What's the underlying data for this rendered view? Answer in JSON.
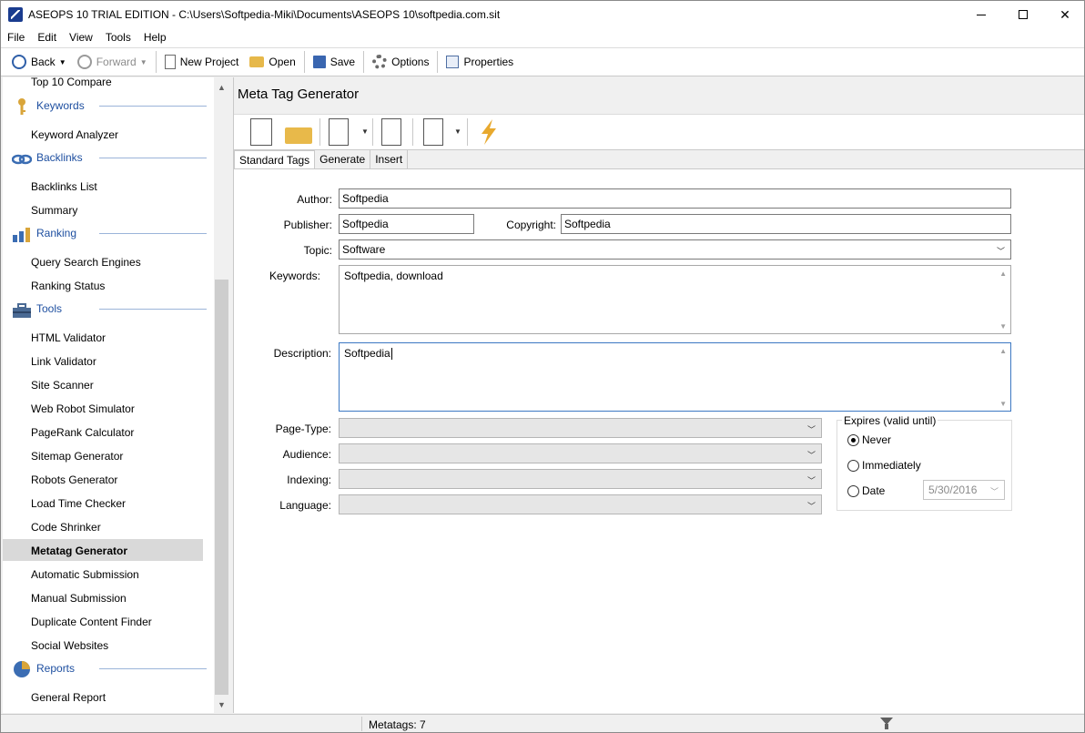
{
  "window": {
    "title": "ASEOPS 10 TRIAL EDITION - C:\\Users\\Softpedia-Miki\\Documents\\ASEOPS 10\\softpedia.com.sit"
  },
  "menu": [
    "File",
    "Edit",
    "View",
    "Tools",
    "Help"
  ],
  "toolbar": {
    "back": "Back",
    "forward": "Forward",
    "new_project": "New Project",
    "open": "Open",
    "save": "Save",
    "options": "Options",
    "properties": "Properties"
  },
  "sidebar": {
    "top_item": "Top 10 Compare",
    "sections": [
      {
        "heading": "Keywords",
        "icon": "key-icon",
        "items": [
          "Keyword Analyzer"
        ]
      },
      {
        "heading": "Backlinks",
        "icon": "chain-link-icon",
        "items": [
          "Backlinks List",
          "Summary"
        ]
      },
      {
        "heading": "Ranking",
        "icon": "ranking-chart-icon",
        "items": [
          "Query Search Engines",
          "Ranking Status"
        ]
      },
      {
        "heading": "Tools",
        "icon": "toolbox-icon",
        "items": [
          "HTML Validator",
          "Link Validator",
          "Site Scanner",
          "Web Robot Simulator",
          "PageRank Calculator",
          "Sitemap Generator",
          "Robots Generator",
          "Load Time Checker",
          "Code Shrinker",
          "Metatag Generator",
          "Automatic Submission",
          "Manual Submission",
          "Duplicate Content Finder",
          "Social Websites"
        ]
      },
      {
        "heading": "Reports",
        "icon": "pie-chart-icon",
        "items": [
          "General Report"
        ]
      }
    ],
    "active_item": "Metatag Generator"
  },
  "main": {
    "title": "Meta Tag Generator",
    "tabs": [
      "Standard Tags",
      "Generate",
      "Insert"
    ],
    "active_tab": "Standard Tags",
    "form": {
      "author_label": "Author:",
      "author_value": "Softpedia",
      "publisher_label": "Publisher:",
      "publisher_value": "Softpedia",
      "copyright_label": "Copyright:",
      "copyright_value": "Softpedia",
      "topic_label": "Topic:",
      "topic_value": "Software",
      "keywords_label": "Keywords:",
      "keywords_value": "Softpedia, download",
      "description_label": "Description:",
      "description_value": "Softpedia",
      "page_type_label": "Page-Type:",
      "audience_label": "Audience:",
      "indexing_label": "Indexing:",
      "language_label": "Language:"
    },
    "expires": {
      "title": "Expires (valid until)",
      "never": "Never",
      "immediately": "Immediately",
      "date": "Date",
      "date_value": "5/30/2016",
      "selected": "Never"
    }
  },
  "status": {
    "text": "Metatags: 7"
  }
}
